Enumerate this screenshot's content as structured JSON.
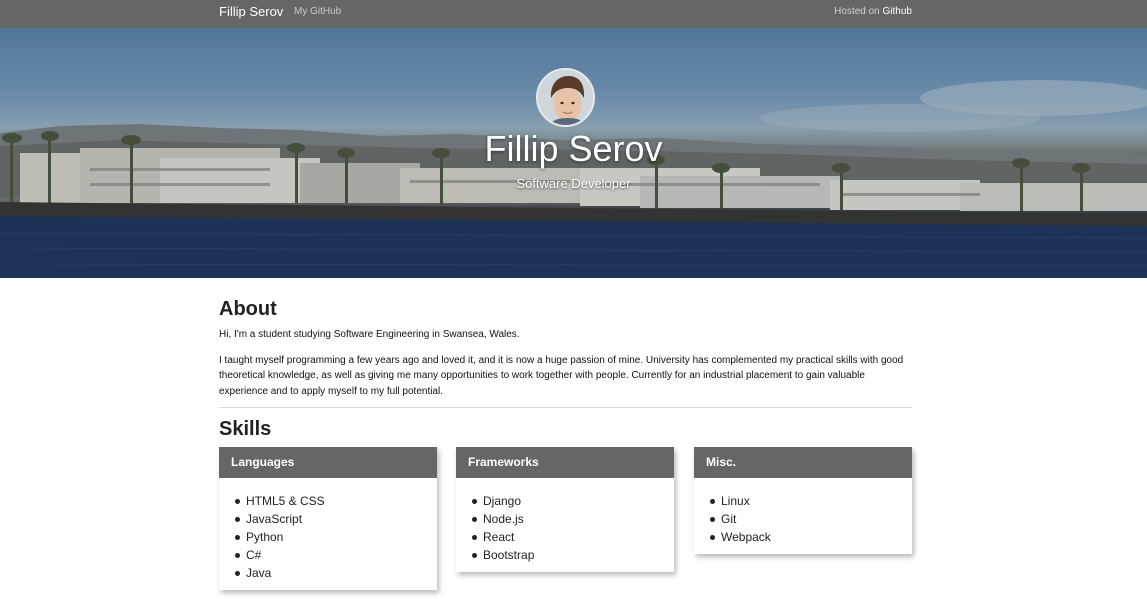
{
  "navbar": {
    "brand": "Fillip Serov",
    "link": "My GitHub",
    "hosted_prefix": "Hosted on",
    "hosted_link": "Github"
  },
  "hero": {
    "name": "Fillip Serov",
    "role": "Software Developer"
  },
  "about": {
    "title": "About",
    "p1": "Hi, I'm a student studying Software Engineering in Swansea, Wales.",
    "p2": "I taught myself programming a few years ago and loved it, and it is now a huge passion of mine. University has complemented my practical skills with good theoretical knowledge, as well as giving me many opportunities to work together with people. Currently for an industrial placement to gain valuable experience and to apply myself to my full potential."
  },
  "skills": {
    "title": "Skills",
    "cards": [
      {
        "title": "Languages",
        "items": [
          "HTML5 & CSS",
          "JavaScript",
          "Python",
          "C#",
          "Java"
        ]
      },
      {
        "title": "Frameworks",
        "items": [
          "Django",
          "Node.js",
          "React",
          "Bootstrap"
        ]
      },
      {
        "title": "Misc.",
        "items": [
          "Linux",
          "Git",
          "Webpack"
        ]
      }
    ]
  },
  "colors": {
    "navbar": "#666666",
    "card_header": "#666666"
  }
}
